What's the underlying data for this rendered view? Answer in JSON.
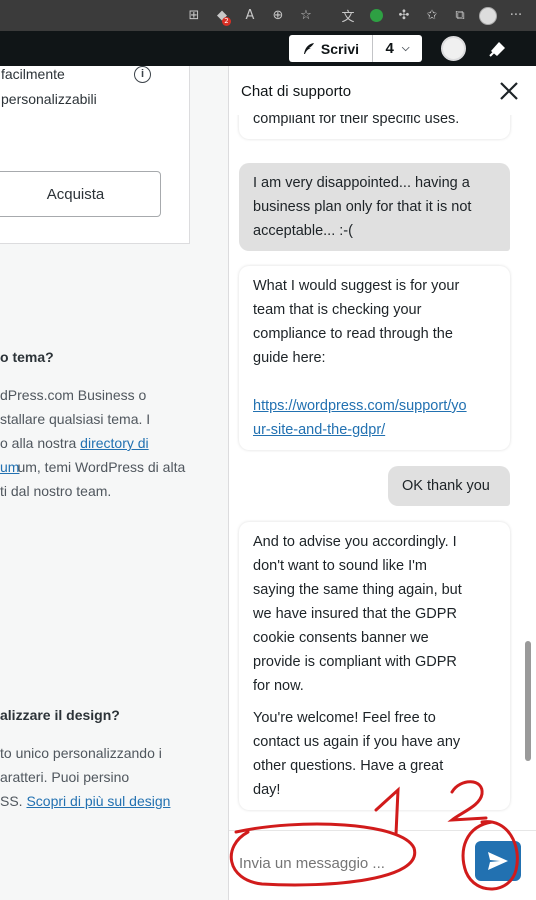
{
  "browser": {
    "icons": [
      "grid-icon",
      "extension-badge-icon",
      "read-aloud-icon",
      "zoom-icon",
      "add-favorite-icon",
      "translate-icon",
      "green-extension-icon",
      "puzzle-icon",
      "favorites-icon",
      "collections-icon",
      "profile-icon",
      "more-icon"
    ],
    "badge_count": "2",
    "more_label": "···"
  },
  "masterbar": {
    "write_label": "Scrivi",
    "site_count": "4"
  },
  "page": {
    "card_feature_lines": [
      "facilmente",
      "personalizzabili"
    ],
    "buy_label": "Acquista",
    "faq1": {
      "question": "o tema?",
      "lines": [
        "dPress.com Business o",
        "stallare qualsiasi tema. I",
        "o alla nostra ",
        "um, temi WordPress di alta",
        "ti dal nostro team."
      ],
      "link_a": "directory di",
      "link_b": "um"
    },
    "faq2": {
      "question": "alizzare il design?",
      "lines": [
        "to unico personalizzando i",
        "aratteri. Puoi persino",
        "SS. "
      ],
      "link": "Scopri di più sul design"
    }
  },
  "chat": {
    "title": "Chat di supporto",
    "messages": [
      {
        "from": "agent",
        "lines": [
          "compliant for their specific uses."
        ]
      },
      {
        "from": "user",
        "lines": [
          "I am very disappointed... having a",
          "business plan only for that it is not",
          "acceptable... :-("
        ]
      },
      {
        "from": "agent",
        "lines": [
          "What I would suggest is for your",
          "team that is checking your",
          "compliance to read through the",
          "guide here:"
        ],
        "link_lines": [
          "https://wordpress.com/support/yo",
          "ur-site-and-the-gdpr/"
        ]
      },
      {
        "from": "user",
        "lines": [
          "OK thank you"
        ]
      },
      {
        "from": "agent",
        "lines": [
          "And to advise you accordingly.  I",
          "don't want to sound like I'm",
          "saying the same thing again, but",
          "we have insured that the GDPR",
          "cookie consents banner we",
          "provide is compliant with GDPR",
          "for now."
        ],
        "lines2": [
          "You're welcome!  Feel free to",
          "contact us again if you have any",
          "other questions.  Have a great",
          "day!"
        ]
      }
    ],
    "input_placeholder": "Invia un messaggio ..."
  },
  "annotations": {
    "label_1": "1",
    "label_2": "2",
    "color": "#d11b1b"
  }
}
